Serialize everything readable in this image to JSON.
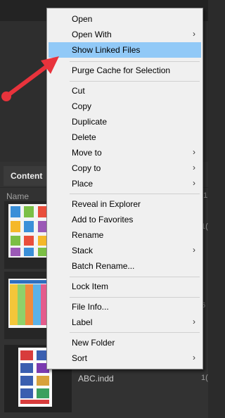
{
  "panel": {
    "tab_label": "Content",
    "column_name": "Name",
    "right_values": [
      "1",
      "1(",
      "6",
      "1("
    ]
  },
  "files": [
    {
      "name": "ABC.indd"
    }
  ],
  "menu": {
    "items": [
      {
        "label": "Open",
        "submenu": false,
        "highlighted": false
      },
      {
        "label": "Open With",
        "submenu": true,
        "highlighted": false
      },
      {
        "label": "Show Linked Files",
        "submenu": false,
        "highlighted": true
      },
      {
        "label": "Purge Cache for Selection",
        "submenu": false,
        "highlighted": false
      },
      {
        "label": "Cut",
        "submenu": false,
        "highlighted": false
      },
      {
        "label": "Copy",
        "submenu": false,
        "highlighted": false
      },
      {
        "label": "Duplicate",
        "submenu": false,
        "highlighted": false
      },
      {
        "label": "Delete",
        "submenu": false,
        "highlighted": false
      },
      {
        "label": "Move to",
        "submenu": true,
        "highlighted": false
      },
      {
        "label": "Copy to",
        "submenu": true,
        "highlighted": false
      },
      {
        "label": "Place",
        "submenu": true,
        "highlighted": false
      },
      {
        "label": "Reveal in Explorer",
        "submenu": false,
        "highlighted": false
      },
      {
        "label": "Add to Favorites",
        "submenu": false,
        "highlighted": false
      },
      {
        "label": "Rename",
        "submenu": false,
        "highlighted": false
      },
      {
        "label": "Stack",
        "submenu": true,
        "highlighted": false
      },
      {
        "label": "Batch Rename...",
        "submenu": false,
        "highlighted": false
      },
      {
        "label": "Lock Item",
        "submenu": false,
        "highlighted": false
      },
      {
        "label": "File Info...",
        "submenu": false,
        "highlighted": false
      },
      {
        "label": "Label",
        "submenu": true,
        "highlighted": false
      },
      {
        "label": "New Folder",
        "submenu": false,
        "highlighted": false
      },
      {
        "label": "Sort",
        "submenu": true,
        "highlighted": false
      }
    ],
    "submenu_arrow": "›"
  },
  "colors": {
    "highlight": "#91c9f7",
    "annotation_arrow": "#e8333c"
  }
}
